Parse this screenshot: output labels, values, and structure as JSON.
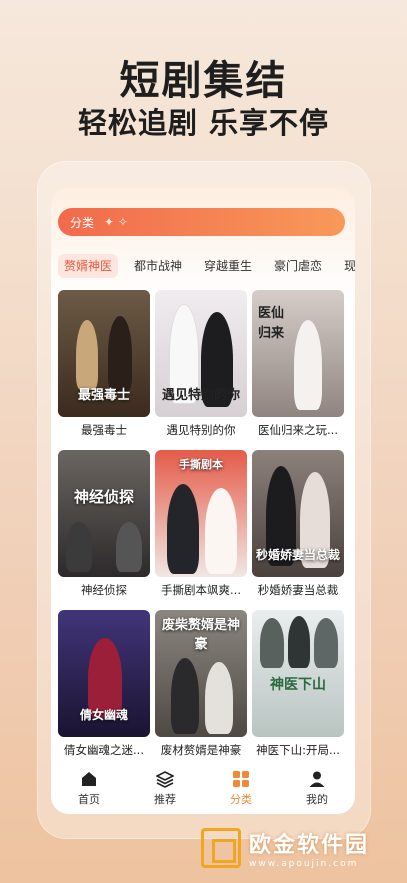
{
  "promo": {
    "headline": "短剧集结",
    "subline": "轻松追剧 乐享不停"
  },
  "search": {
    "label": "分类",
    "decoration": "✦ ✧"
  },
  "tabs": [
    {
      "label": "赘婿神医",
      "active": true
    },
    {
      "label": "都市战神"
    },
    {
      "label": "穿越重生"
    },
    {
      "label": "豪门虐恋"
    },
    {
      "label": "现言"
    }
  ],
  "cards": [
    {
      "title": "最强毒士",
      "poster_text": "最强毒士",
      "bg": "#3b2a1e"
    },
    {
      "title": "遇见特别的你",
      "poster_text": "遇见特别的你",
      "bg": "#e9e4e6"
    },
    {
      "title": "医仙归来之玩...",
      "poster_text": "医仙归来",
      "bg": "#b5a9a6"
    },
    {
      "title": "神经侦探",
      "poster_text": "神经侦探",
      "bg": "#2d2a2c"
    },
    {
      "title": "手撕剧本飒爽...",
      "poster_text": "手撕剧本",
      "bg": "#c74a3d"
    },
    {
      "title": "秒婚娇妻当总裁",
      "poster_text": "秒婚娇妻当总裁",
      "bg": "#7a6d67"
    },
    {
      "title": "倩女幽魂之迷...",
      "poster_text": "倩女幽魂",
      "bg": "#2b2154"
    },
    {
      "title": "废材赘婿是神豪",
      "poster_text": "废柴赘婿是神豪",
      "bg": "#6f6a66"
    },
    {
      "title": "神医下山:开局...",
      "poster_text": "神医下山",
      "bg": "#c8d1cf"
    }
  ],
  "nav": [
    {
      "label": "首页",
      "icon": "home-icon"
    },
    {
      "label": "推荐",
      "icon": "layers-icon"
    },
    {
      "label": "分类",
      "icon": "grid-icon",
      "active": true
    },
    {
      "label": "我的",
      "icon": "user-icon"
    }
  ],
  "watermark": {
    "title": "欧金软件园",
    "url": "www.apoujin.com"
  }
}
